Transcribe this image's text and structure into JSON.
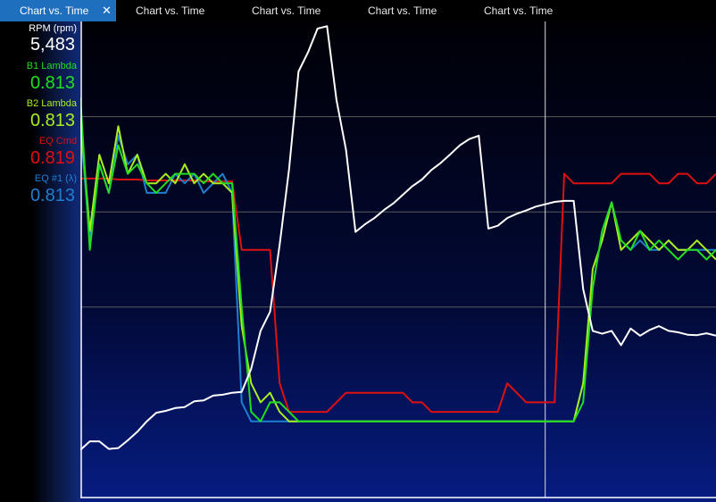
{
  "tabs": [
    {
      "label": "Chart vs. Time",
      "active": true
    },
    {
      "label": "Chart vs. Time",
      "active": false
    },
    {
      "label": "Chart vs. Time",
      "active": false
    },
    {
      "label": "Chart vs. Time",
      "active": false
    },
    {
      "label": "Chart vs. Time",
      "active": false
    }
  ],
  "close_glyph": "✕",
  "legend": [
    {
      "name": "RPM (rpm)",
      "value": "5,483",
      "color": "#ffffff"
    },
    {
      "name": "B1 Lambda",
      "value": "0.813",
      "color": "#22dd22"
    },
    {
      "name": "B2 Lambda",
      "value": "0.813",
      "color": "#aaee22"
    },
    {
      "name": "EQ Cmd",
      "value": "0.819",
      "color": "#dd1111"
    },
    {
      "name": "EQ #1 (λ)",
      "value": "0.813",
      "color": "#1e7fd0"
    }
  ],
  "chart_data": {
    "type": "line",
    "x": [
      0,
      4,
      8,
      12,
      16,
      20,
      24,
      28,
      32,
      36,
      40,
      44,
      48,
      52,
      56,
      60,
      64,
      68,
      72,
      76,
      80,
      84,
      88,
      92,
      96,
      100,
      104,
      108,
      112,
      116,
      120,
      124,
      128,
      132,
      136,
      140,
      144,
      148,
      152,
      156,
      160,
      164,
      168,
      172,
      176,
      180,
      184,
      188,
      192,
      196,
      200,
      204,
      208,
      212,
      216,
      220,
      224,
      228,
      232,
      236,
      240,
      244,
      248,
      252,
      256,
      260,
      264,
      268
    ],
    "series": [
      {
        "key": "rpm",
        "color": "#ffffff",
        "values": [
          1000,
          1180,
          1180,
          1020,
          1040,
          1200,
          1380,
          1600,
          1780,
          1820,
          1880,
          1900,
          2020,
          2040,
          2140,
          2160,
          2200,
          2220,
          2700,
          3500,
          3900,
          5300,
          6900,
          8950,
          9350,
          9850,
          9900,
          8350,
          7300,
          5580,
          5740,
          5870,
          6040,
          6180,
          6360,
          6540,
          6680,
          6880,
          7030,
          7210,
          7400,
          7530,
          7600,
          5650,
          5710,
          5870,
          5960,
          6030,
          6110,
          6160,
          6210,
          6230,
          6230,
          4380,
          3500,
          3440,
          3500,
          3200,
          3550,
          3400,
          3520,
          3600,
          3500,
          3470,
          3420,
          3410,
          3450,
          3400
        ]
      },
      {
        "key": "b1",
        "color": "#22dd22",
        "values": [
          1.02,
          0.86,
          0.95,
          0.92,
          0.97,
          0.94,
          0.95,
          0.93,
          0.92,
          0.93,
          0.94,
          0.94,
          0.94,
          0.93,
          0.94,
          0.93,
          0.93,
          0.8,
          0.69,
          0.68,
          0.7,
          0.7,
          0.69,
          0.68,
          0.68,
          0.68,
          0.68,
          0.68,
          0.68,
          0.68,
          0.68,
          0.68,
          0.68,
          0.68,
          0.68,
          0.68,
          0.68,
          0.68,
          0.68,
          0.68,
          0.68,
          0.68,
          0.68,
          0.68,
          0.68,
          0.68,
          0.68,
          0.68,
          0.68,
          0.68,
          0.68,
          0.68,
          0.68,
          0.7,
          0.82,
          0.88,
          0.91,
          0.87,
          0.86,
          0.88,
          0.86,
          0.87,
          0.86,
          0.85,
          0.86,
          0.86,
          0.85,
          0.86
        ]
      },
      {
        "key": "b2",
        "color": "#aaee22",
        "values": [
          1.0,
          0.88,
          0.96,
          0.93,
          0.99,
          0.94,
          0.96,
          0.93,
          0.93,
          0.94,
          0.93,
          0.95,
          0.93,
          0.94,
          0.93,
          0.93,
          0.92,
          0.78,
          0.72,
          0.7,
          0.71,
          0.69,
          0.68,
          0.68,
          0.68,
          0.68,
          0.68,
          0.68,
          0.68,
          0.68,
          0.68,
          0.68,
          0.68,
          0.68,
          0.68,
          0.68,
          0.68,
          0.68,
          0.68,
          0.68,
          0.68,
          0.68,
          0.68,
          0.68,
          0.68,
          0.68,
          0.68,
          0.68,
          0.68,
          0.68,
          0.68,
          0.68,
          0.68,
          0.72,
          0.84,
          0.87,
          0.91,
          0.86,
          0.87,
          0.88,
          0.87,
          0.86,
          0.87,
          0.86,
          0.86,
          0.87,
          0.86,
          0.85
        ]
      },
      {
        "key": "eqcmd",
        "color": "#dd1111",
        "values": [
          0.935,
          0.935,
          0.935,
          0.935,
          0.934,
          0.934,
          0.934,
          0.933,
          0.933,
          0.933,
          0.933,
          0.933,
          0.933,
          0.932,
          0.932,
          0.932,
          0.932,
          0.86,
          0.86,
          0.86,
          0.86,
          0.72,
          0.69,
          0.69,
          0.69,
          0.69,
          0.69,
          0.7,
          0.71,
          0.71,
          0.71,
          0.71,
          0.71,
          0.71,
          0.71,
          0.7,
          0.7,
          0.69,
          0.69,
          0.69,
          0.69,
          0.69,
          0.69,
          0.69,
          0.69,
          0.72,
          0.71,
          0.7,
          0.7,
          0.7,
          0.7,
          0.94,
          0.93,
          0.93,
          0.93,
          0.93,
          0.93,
          0.94,
          0.94,
          0.94,
          0.94,
          0.93,
          0.93,
          0.94,
          0.94,
          0.93,
          0.93,
          0.94
        ]
      },
      {
        "key": "eq1",
        "color": "#1e7fd0",
        "values": [
          0.99,
          0.87,
          0.95,
          0.92,
          0.98,
          0.95,
          0.96,
          0.92,
          0.92,
          0.92,
          0.94,
          0.93,
          0.94,
          0.92,
          0.93,
          0.94,
          0.92,
          0.7,
          0.68,
          0.68,
          0.68,
          0.68,
          0.68,
          0.68,
          0.68,
          0.68,
          0.68,
          0.68,
          0.68,
          0.68,
          0.68,
          0.68,
          0.68,
          0.68,
          0.68,
          0.68,
          0.68,
          0.68,
          0.68,
          0.68,
          0.68,
          0.68,
          0.68,
          0.68,
          0.68,
          0.68,
          0.68,
          0.68,
          0.68,
          0.68,
          0.68,
          0.68,
          0.68,
          0.72,
          0.82,
          0.88,
          0.91,
          0.87,
          0.86,
          0.87,
          0.86,
          0.86,
          0.87,
          0.86,
          0.86,
          0.86,
          0.86,
          0.86
        ]
      }
    ],
    "rpm_range": [
      0,
      10000
    ],
    "lambda_range": [
      0.6,
      1.1
    ],
    "grid_lambda": [
      0.8,
      0.9,
      1.0
    ],
    "cursor_x": 196
  }
}
